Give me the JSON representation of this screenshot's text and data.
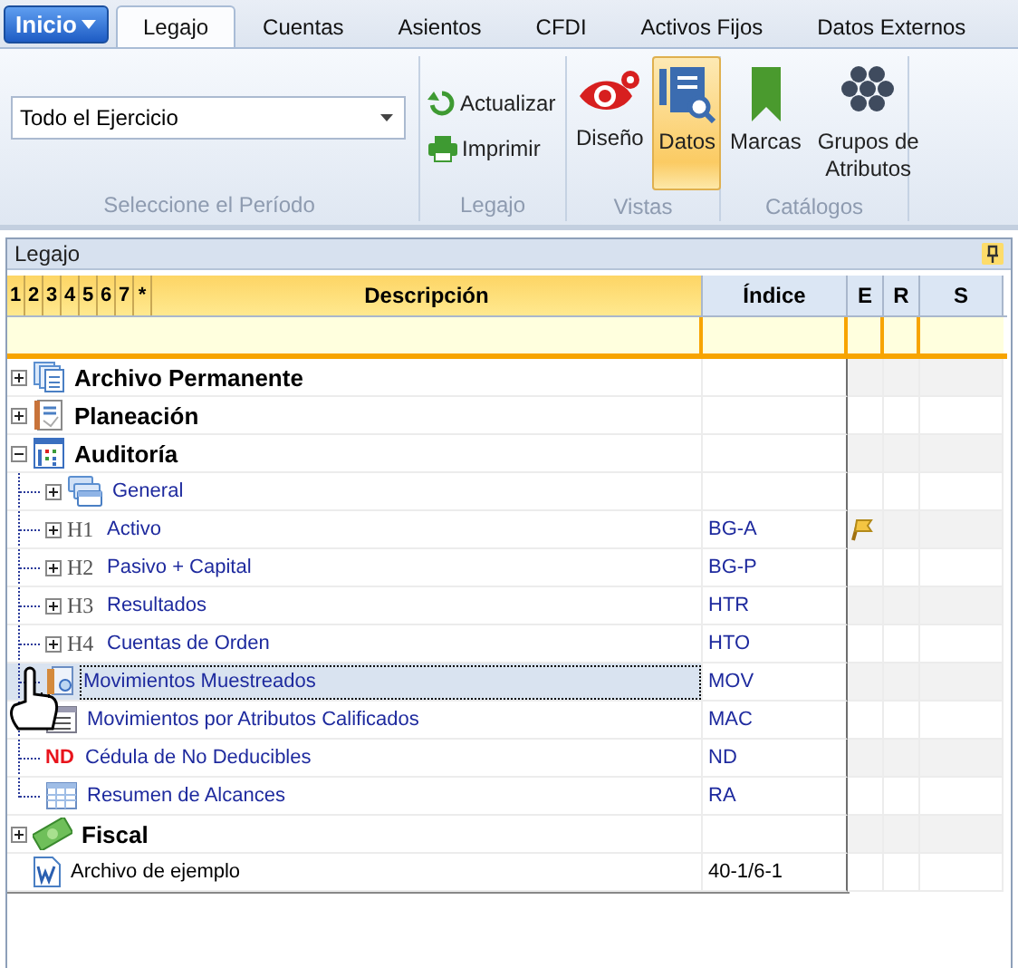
{
  "app_button": {
    "label": "Inicio"
  },
  "tabs": [
    {
      "label": "Legajo",
      "selected": true
    },
    {
      "label": "Cuentas",
      "selected": false
    },
    {
      "label": "Asientos",
      "selected": false
    },
    {
      "label": "CFDI",
      "selected": false
    },
    {
      "label": "Activos Fijos",
      "selected": false
    },
    {
      "label": "Datos Externos",
      "selected": false
    }
  ],
  "ribbon": {
    "groups": [
      {
        "kind": "period",
        "caption": "Seleccione el Período",
        "value": "Todo el Ejercicio"
      },
      {
        "kind": "small",
        "caption": "Legajo",
        "buttons": [
          {
            "label": "Actualizar"
          },
          {
            "label": "Imprimir"
          }
        ]
      },
      {
        "kind": "large",
        "caption": "Vistas",
        "buttons": [
          {
            "label": "Diseño",
            "selected": false
          },
          {
            "label": "Datos",
            "selected": true
          }
        ]
      },
      {
        "kind": "large",
        "caption": "Catálogos",
        "buttons": [
          {
            "label": "Marcas"
          },
          {
            "label": "Grupos de Atributos"
          }
        ]
      }
    ]
  },
  "panel": {
    "title": "Legajo"
  },
  "grid": {
    "level_columns": [
      "1",
      "2",
      "3",
      "4",
      "5",
      "6",
      "7",
      "*"
    ],
    "columns": [
      "Descripción",
      "Índice",
      "E",
      "R",
      "S"
    ],
    "rows": [
      {
        "label": "Archivo Permanente",
        "kind": "section",
        "expanded": false,
        "selected": false,
        "flagged": false
      },
      {
        "label": "Planeación",
        "kind": "section",
        "expanded": false,
        "selected": false,
        "flagged": false
      },
      {
        "label": "Auditoría",
        "kind": "section",
        "expanded": true,
        "selected": false,
        "flagged": false,
        "children": [
          {
            "label": "General",
            "kind": "item",
            "expanded": false,
            "selected": false,
            "flagged": false
          },
          {
            "label": "Activo",
            "kind": "item",
            "prefix": "H1",
            "index": "BG-A",
            "expanded": false,
            "selected": false,
            "flagged": true
          },
          {
            "label": "Pasivo + Capital",
            "kind": "item",
            "prefix": "H2",
            "index": "BG-P",
            "expanded": false,
            "selected": false,
            "flagged": false
          },
          {
            "label": "Resultados",
            "kind": "item",
            "prefix": "H3",
            "index": "HTR",
            "expanded": false,
            "selected": false,
            "flagged": false
          },
          {
            "label": "Cuentas de Orden",
            "kind": "item",
            "prefix": "H4",
            "index": "HTO",
            "expanded": false,
            "selected": false,
            "flagged": false
          },
          {
            "label": "Movimientos Muestreados",
            "kind": "item",
            "index": "MOV",
            "selected": true,
            "flagged": false
          },
          {
            "label": "Movimientos por Atributos Calificados",
            "kind": "item",
            "index": "MAC",
            "selected": false,
            "flagged": false
          },
          {
            "label": "Cédula de No Deducibles",
            "kind": "item",
            "prefix": "ND",
            "index": "ND",
            "selected": false,
            "flagged": false
          },
          {
            "label": "Resumen de Alcances",
            "kind": "item",
            "index": "RA",
            "selected": false,
            "flagged": false
          }
        ]
      },
      {
        "label": "Fiscal",
        "kind": "section",
        "expanded": false,
        "selected": false,
        "flagged": false
      },
      {
        "label": "Archivo de ejemplo",
        "kind": "file",
        "index": "40-1/6-1",
        "selected": false,
        "flagged": false
      }
    ]
  }
}
